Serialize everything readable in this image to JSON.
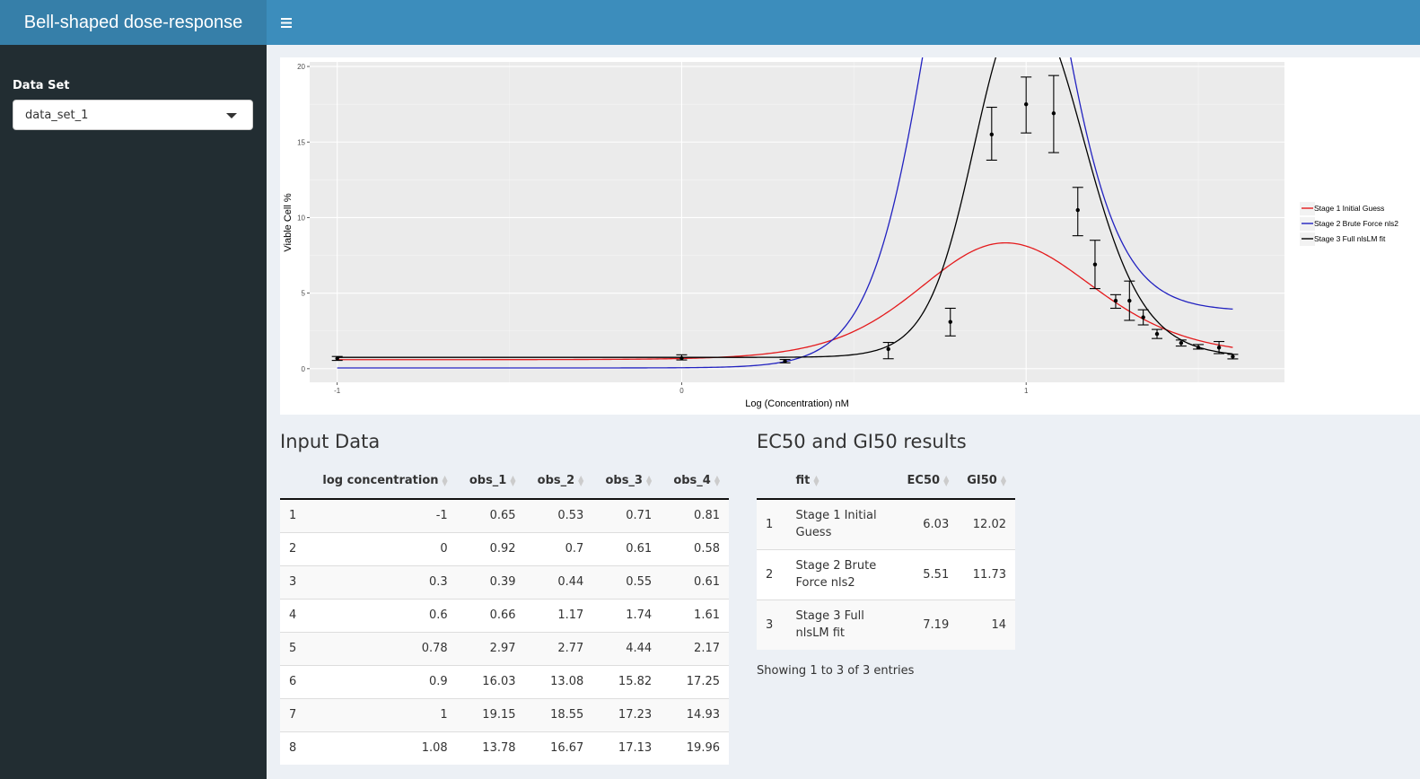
{
  "app": {
    "title": "Bell-shaped dose-response",
    "menu_icon": "hamburger-icon"
  },
  "sidebar": {
    "dataset_label": "Data Set",
    "dataset_value": "data_set_1"
  },
  "chart_data": {
    "type": "line",
    "xlabel": "Log (Concentration) nM",
    "ylabel": "Viable Cell %",
    "xlim": [
      -1.08,
      1.75
    ],
    "ylim": [
      -0.9,
      20.3
    ],
    "x_ticks": [
      -1,
      0,
      1
    ],
    "y_ticks": [
      0,
      5,
      10,
      15,
      20
    ],
    "grid": true,
    "legend_placement": "right",
    "series": [
      {
        "name": "Stage 1 Initial Guess",
        "color": "#e41a1c",
        "params": {
          "bottom": 0.6,
          "top": 0.8,
          "a": 17.9,
          "ec50": 0.78,
          "b1": 6.6,
          "gi50": 1.08,
          "b2": 6.1
        }
      },
      {
        "name": "Stage 2 Brute Force nls2",
        "color": "#2222c0",
        "params": {
          "bottom": 0.05,
          "top": 3.8,
          "a": 55,
          "ec50": 0.74,
          "b1": 11,
          "gi50": 1.07,
          "b2": 11
        }
      },
      {
        "name": "Stage 3 Full nlsLM fit",
        "color": "#000000",
        "params": {
          "bottom": 0.75,
          "top": 0.75,
          "a": 33.5,
          "ec50": 0.86,
          "b1": 14,
          "gi50": 1.15,
          "b2": 11
        }
      }
    ],
    "observations": [
      {
        "x": -1,
        "mean": 0.68,
        "lo": 0.55,
        "hi": 0.81
      },
      {
        "x": 0,
        "mean": 0.7,
        "lo": 0.58,
        "hi": 0.92
      },
      {
        "x": 0.3,
        "mean": 0.5,
        "lo": 0.39,
        "hi": 0.61
      },
      {
        "x": 0.6,
        "mean": 1.3,
        "lo": 0.66,
        "hi": 1.74
      },
      {
        "x": 0.78,
        "mean": 3.1,
        "lo": 2.17,
        "hi": 4.0
      },
      {
        "x": 0.9,
        "mean": 15.5,
        "lo": 13.8,
        "hi": 17.3
      },
      {
        "x": 1,
        "mean": 17.5,
        "lo": 15.6,
        "hi": 19.3
      },
      {
        "x": 1.08,
        "mean": 16.9,
        "lo": 14.3,
        "hi": 19.4
      },
      {
        "x": 1.15,
        "mean": 10.5,
        "lo": 8.8,
        "hi": 12.0
      },
      {
        "x": 1.2,
        "mean": 6.9,
        "lo": 5.3,
        "hi": 8.5
      },
      {
        "x": 1.26,
        "mean": 4.5,
        "lo": 4.0,
        "hi": 4.9
      },
      {
        "x": 1.3,
        "mean": 4.5,
        "lo": 3.2,
        "hi": 5.8
      },
      {
        "x": 1.34,
        "mean": 3.4,
        "lo": 2.9,
        "hi": 3.9
      },
      {
        "x": 1.38,
        "mean": 2.3,
        "lo": 2.0,
        "hi": 2.6
      },
      {
        "x": 1.45,
        "mean": 1.7,
        "lo": 1.5,
        "hi": 1.9
      },
      {
        "x": 1.5,
        "mean": 1.4,
        "lo": 1.3,
        "hi": 1.6
      },
      {
        "x": 1.56,
        "mean": 1.4,
        "lo": 1.0,
        "hi": 1.8
      },
      {
        "x": 1.6,
        "mean": 0.8,
        "lo": 0.65,
        "hi": 0.95
      }
    ]
  },
  "input_data": {
    "title": "Input Data",
    "columns": [
      "",
      "log concentration",
      "obs_1",
      "obs_2",
      "obs_3",
      "obs_4"
    ],
    "rows": [
      [
        "1",
        "-1",
        "0.65",
        "0.53",
        "0.71",
        "0.81"
      ],
      [
        "2",
        "0",
        "0.92",
        "0.7",
        "0.61",
        "0.58"
      ],
      [
        "3",
        "0.3",
        "0.39",
        "0.44",
        "0.55",
        "0.61"
      ],
      [
        "4",
        "0.6",
        "0.66",
        "1.17",
        "1.74",
        "1.61"
      ],
      [
        "5",
        "0.78",
        "2.97",
        "2.77",
        "4.44",
        "2.17"
      ],
      [
        "6",
        "0.9",
        "16.03",
        "13.08",
        "15.82",
        "17.25"
      ],
      [
        "7",
        "1",
        "19.15",
        "18.55",
        "17.23",
        "14.93"
      ],
      [
        "8",
        "1.08",
        "13.78",
        "16.67",
        "17.13",
        "19.96"
      ]
    ]
  },
  "results": {
    "title": "EC50 and GI50 results",
    "columns": [
      "",
      "fit",
      "EC50",
      "GI50"
    ],
    "rows": [
      [
        "1",
        "Stage 1 Initial Guess",
        "6.03",
        "12.02"
      ],
      [
        "2",
        "Stage 2 Brute Force nls2",
        "5.51",
        "11.73"
      ],
      [
        "3",
        "Stage 3 Full nlsLM fit",
        "7.19",
        "14"
      ]
    ],
    "info": "Showing 1 to 3 of 3 entries"
  }
}
